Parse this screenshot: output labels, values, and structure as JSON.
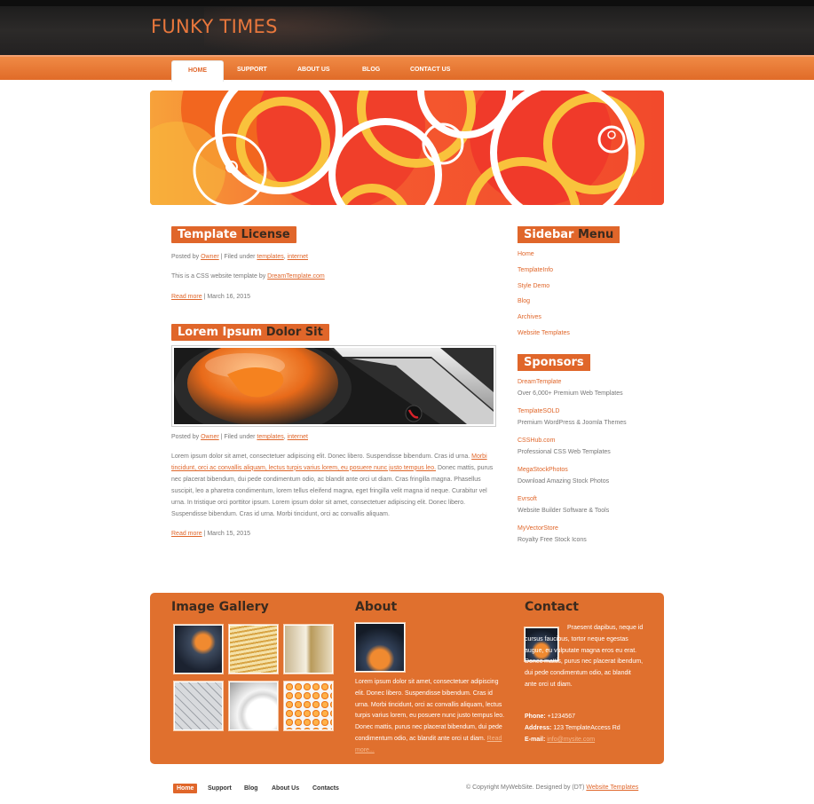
{
  "site": {
    "title": "FUNKY TIMES"
  },
  "nav": {
    "items": [
      {
        "label": "HOME",
        "active": true
      },
      {
        "label": "SUPPORT",
        "active": false
      },
      {
        "label": "ABOUT US",
        "active": false
      },
      {
        "label": "BLOG",
        "active": false
      },
      {
        "label": "CONTACT US",
        "active": false
      }
    ]
  },
  "posts": [
    {
      "title_a": "Template ",
      "title_b": "License",
      "meta_prefix": "Posted by ",
      "author": "Owner",
      "meta_mid": " | Filed under ",
      "tag1": "templates",
      "tag_sep": ", ",
      "tag2": "internet",
      "body_prefix": "This is a CSS website template by ",
      "body_link": "DreamTemplate.com",
      "read_more": "Read more",
      "date": " | March 16, 2015"
    },
    {
      "title_a": "Lorem Ipsum ",
      "title_b": "Dolor Sit",
      "meta_prefix": "Posted by ",
      "author": "Owner",
      "meta_mid": " | Filed under ",
      "tag1": "templates",
      "tag_sep": ", ",
      "tag2": "internet",
      "body_1": "Lorem ipsum dolor sit amet, consectetuer adipiscing elit. Donec libero. Suspendisse bibendum. Cras id urna. ",
      "body_link": "Morbi tincidunt, orci ac convallis aliquam, lectus turpis varius lorem, eu posuere nunc justo tempus leo.",
      "body_2": " Donec mattis, purus nec placerat bibendum, dui pede condimentum odio, ac blandit ante orci ut diam. Cras fringilla magna. Phasellus suscipit, leo a pharetra condimentum, lorem tellus eleifend magna, eget fringilla velit magna id neque. Curabitur vel urna. In tristique orci porttitor ipsum. Lorem ipsum dolor sit amet, consectetuer adipiscing elit. Donec libero. Suspendisse bibendum. Cras id urna. Morbi tincidunt, orci ac convallis aliquam.",
      "read_more": "Read more",
      "date": " | March 15, 2015"
    }
  ],
  "sidebar": {
    "menu_title_a": "Sidebar ",
    "menu_title_b": "Menu",
    "menu": [
      "Home",
      "TemplateInfo",
      "Style Demo",
      "Blog",
      "Archives",
      "Website Templates"
    ],
    "sponsors_title": "Sponsors",
    "sponsors": [
      {
        "name": "DreamTemplate",
        "desc": "Over 6,000+ Premium Web Templates"
      },
      {
        "name": "TemplateSOLD",
        "desc": "Premium WordPress & Joomla Themes"
      },
      {
        "name": "CSSHub.com",
        "desc": "Professional CSS Web Templates"
      },
      {
        "name": "MegaStockPhotos",
        "desc": "Download Amazing Stock Photos"
      },
      {
        "name": "Evrsoft",
        "desc": "Website Builder Software & Tools"
      },
      {
        "name": "MyVectorStore",
        "desc": "Royalty Free Stock Icons"
      }
    ]
  },
  "footer": {
    "gallery_title": "Image Gallery",
    "about_title": "About",
    "about_text": "Lorem ipsum dolor sit amet, consectetuer adipiscing elit. Donec libero. Suspendisse bibendum. Cras id urna. Morbi tincidunt, orci ac convallis aliquam, lectus turpis varius lorem, eu posuere nunc justo tempus leo. Donec mattis, purus nec placerat bibendum, dui pede condimentum odio, ac blandit ante orci ut diam.",
    "about_more": "Read more...",
    "contact_title": "Contact",
    "contact_text": "Praesent dapibus, neque id cursus faucibus, tortor neque egestas augue, eu vulputate magna eros eu erat. Donec mattis, purus nec placerat ibendum, dui pede condimentum odio, ac blandit ante orci ut diam.",
    "phone_label": "Phone:",
    "phone": " +1234567",
    "address_label": "Address:",
    "address": " 123 TemplateAccess Rd",
    "email_label": "E-mail:",
    "email": "info@mysite.com"
  },
  "bottom": {
    "nav": [
      "Home",
      "Support",
      "Blog",
      "About Us",
      "Contacts"
    ],
    "copyright_prefix": "© Copyright MyWebSite. Designed by (DT) ",
    "copyright_link": "Website Templates"
  },
  "colors": {
    "accent": "#e0662a",
    "header_dark": "#232121",
    "title_dark": "#3a2a1e"
  }
}
